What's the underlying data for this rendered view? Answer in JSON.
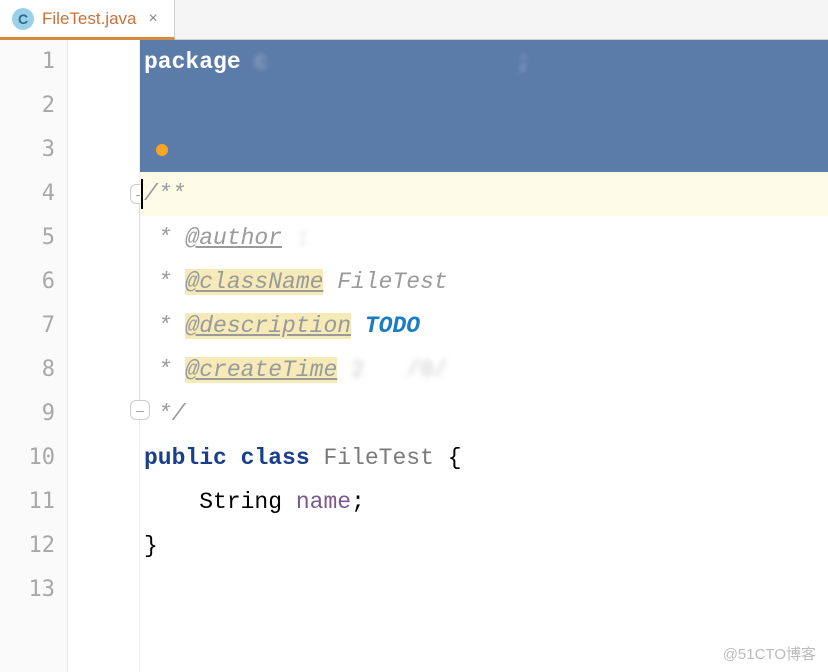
{
  "tab": {
    "icon_letter": "C",
    "filename": "FileTest.java",
    "close": "×"
  },
  "gutter": {
    "lines": [
      "1",
      "2",
      "3",
      "4",
      "5",
      "6",
      "7",
      "8",
      "9",
      "10",
      "11",
      "12",
      "13"
    ]
  },
  "code": {
    "package_kw": "package",
    "package_name": " c                  ;",
    "dot": "",
    "doc_open": "/**",
    "star": " * ",
    "author_tag": "@author",
    "author_val": " :          ",
    "classname_tag": "@className",
    "classname_val": " FileTest",
    "description_tag": "@description",
    "description_val": " ",
    "todo": "TODO",
    "createtime_tag": "@createTime",
    "createtime_val": " 2   /0/           ",
    "doc_close": " */",
    "public_kw": "public",
    "class_kw": "class",
    "class_name": "FileTest",
    "brace_open": " {",
    "field_type": "String",
    "field_name": "name",
    "semicolon": ";",
    "brace_close": "}"
  },
  "watermark": "@51CTO博客"
}
